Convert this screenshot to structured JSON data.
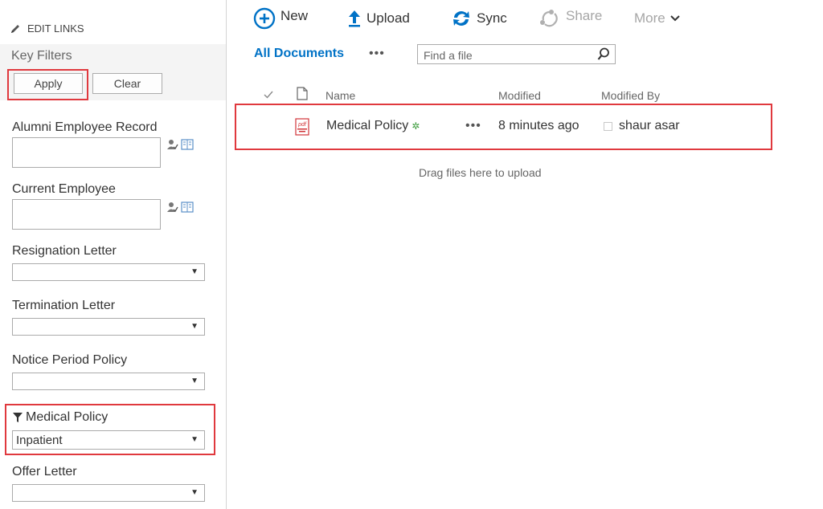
{
  "left_pane": {
    "edit_links": "EDIT LINKS",
    "key_filters_title": "Key Filters",
    "apply_label": "Apply",
    "clear_label": "Clear",
    "filters": [
      {
        "label": "Alumni Employee Record",
        "type": "people",
        "value": ""
      },
      {
        "label": "Current Employee",
        "type": "people",
        "value": ""
      },
      {
        "label": "Resignation Letter",
        "type": "select",
        "value": ""
      },
      {
        "label": "Termination Letter",
        "type": "select",
        "value": ""
      },
      {
        "label": "Notice Period Policy",
        "type": "select",
        "value": ""
      },
      {
        "label": "Medical Policy",
        "type": "select",
        "value": "Inpatient",
        "active": true
      },
      {
        "label": "Offer Letter",
        "type": "select",
        "value": ""
      }
    ]
  },
  "toolbar": {
    "new_label": "New",
    "upload_label": "Upload",
    "sync_label": "Sync",
    "share_label": "Share",
    "more_label": "More"
  },
  "view": {
    "name": "All Documents",
    "ellipsis": "•••",
    "search_placeholder": "Find a file"
  },
  "columns": {
    "name": "Name",
    "modified": "Modified",
    "modified_by": "Modified By"
  },
  "rows": [
    {
      "file_icon": "pdf-icon",
      "file_icon_text": "pdf",
      "name": "Medical Policy",
      "new_badge": "✲",
      "ellipsis": "•••",
      "modified": "8 minutes ago",
      "modified_by": "shaur asar"
    }
  ],
  "drag_hint": "Drag files here to upload",
  "colors": {
    "accent": "#0072c6",
    "highlight": "#e0393e",
    "pdf_red": "#d13438",
    "new_badge_green": "#3a9a3a"
  }
}
